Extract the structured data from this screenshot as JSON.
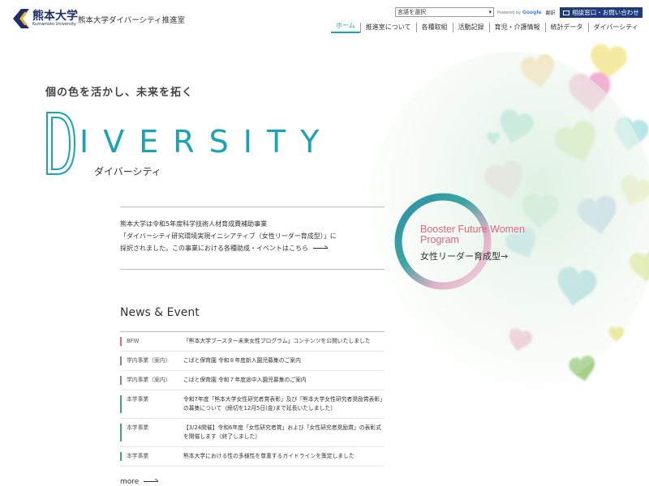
{
  "header": {
    "logo_jp": "熊本大学",
    "logo_en": "Kumamoto University",
    "office_name": "熊本大学ダイバーシティ推進室",
    "lang_select": "言語を選択",
    "powered_by": "Powered by",
    "google": "Google",
    "translate": "翻訳",
    "consult": "相談窓口・お問い合わせ",
    "nav": [
      "ホーム",
      "推進室について",
      "各種取組",
      "活動記録",
      "育児・介護情報",
      "統計データ",
      "ダイバーシティ"
    ]
  },
  "hero": {
    "tagline": "個の色を活かし、未来を拓く",
    "title_initial": "D",
    "title_rest": "IVERSITY",
    "subtitle": "ダイバーシティ",
    "intro": [
      "熊本大学は令和5年度科学技術人材育成費補助事業",
      "「ダイバーシティ研究環境実現イニシアティブ（女性リーダー育成型）」に",
      "採択されました。この事業における各種助成・イベントはこちら"
    ],
    "bfw_title": [
      "Booster Future Women",
      "Program"
    ],
    "bfw_sub": "女性リーダー育成型→"
  },
  "news": {
    "title": "News & Event",
    "items": [
      {
        "category": "BFW",
        "text": "「熊本大学ブースター未来女性プログラム」コンテンツを公開いたしました",
        "color": "pink"
      },
      {
        "category": "学内事業（案内）",
        "text": "こばと保育園 令和８年度新入園児募集のご案内",
        "color": "purple"
      },
      {
        "category": "学内事業（案内）",
        "text": "こばと保育園 令和７年度途中入園児募集のご案内",
        "color": "purple"
      },
      {
        "category": "本学事業",
        "text": "令和7年度「熊本大学女性研究者賞表彰」及び「熊本大学女性研究者奨励賞表彰」の募集について（締切を12月5日(金)まで延長いたしました）",
        "color": "green"
      },
      {
        "category": "本学事業",
        "text": "【3/24開催】令和6年度「女性研究者賞」および「女性研究者奨励賞」の表彰式を開催します（終了しました）",
        "color": "green"
      },
      {
        "category": "本学事業",
        "text": "熊本大学における性の多様性を尊重するガイドラインを策定しました",
        "color": "green"
      }
    ],
    "more": "more"
  }
}
